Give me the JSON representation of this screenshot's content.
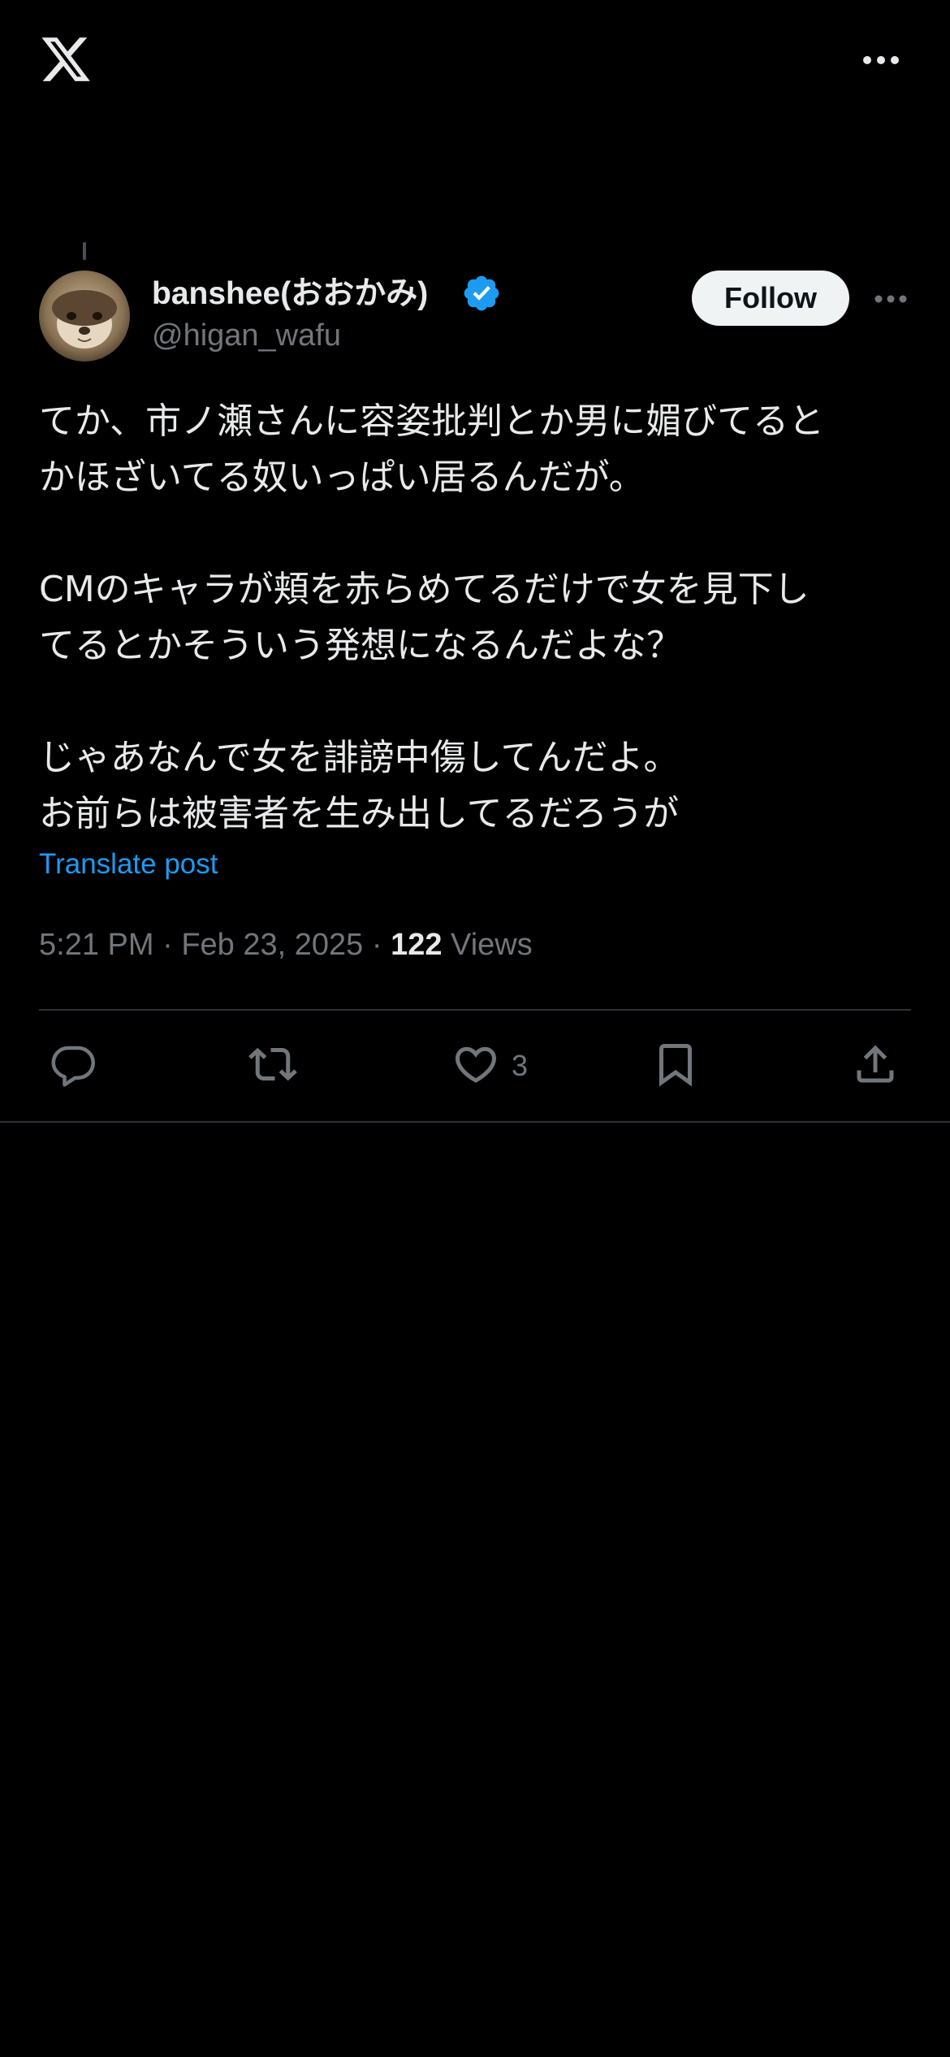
{
  "header": {
    "logo_icon": "x-logo-icon",
    "more_icon": "more-horizontal-icon"
  },
  "post": {
    "author": {
      "display_name": "banshee(おおかみ)",
      "handle": "@higan_wafu",
      "verified": true,
      "verified_color": "#1d9bf0"
    },
    "follow_label": "Follow",
    "body": "てか、市ノ瀬さんに容姿批判とか男に媚びてると\nかほざいてる奴いっぱい居るんだが。\n\nCMのキャラが頬を赤らめてるだけで女を見下し\nてるとかそういう発想になるんだよな？\n\nじゃあなんで女を誹謗中傷してんだよ。\nお前らは被害者を生み出してるだろうが",
    "translate_label": "Translate post",
    "time": "5:21 PM",
    "separator": "·",
    "date": "Feb 23, 2025",
    "views_count": "122",
    "views_label": "Views",
    "like_count": "3"
  },
  "actions": [
    {
      "icon": "reply-icon"
    },
    {
      "icon": "repost-icon"
    },
    {
      "icon": "like-icon"
    },
    {
      "icon": "bookmark-icon"
    },
    {
      "icon": "share-icon"
    }
  ],
  "colors": {
    "background": "#000000",
    "text": "#e7e9ea",
    "secondary_text": "#71767b",
    "link": "#1d9bf0",
    "divider": "#2f3336",
    "follow_bg": "#eff3f4"
  }
}
